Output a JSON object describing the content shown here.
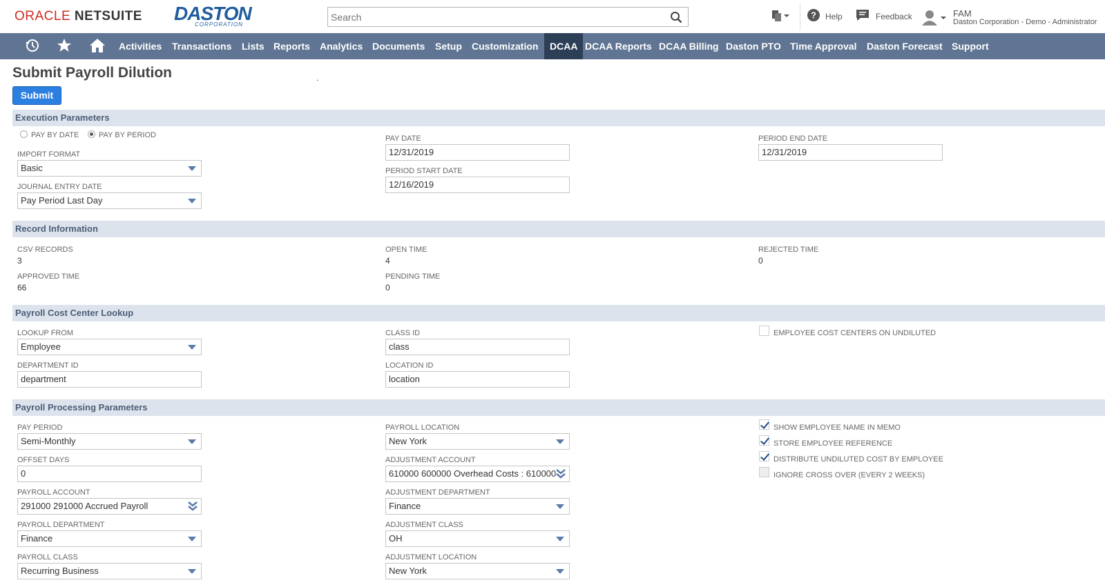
{
  "header": {
    "oracle_word": "ORACLE",
    "netsuite_word": "NETSUITE",
    "daston_word": "DASTON",
    "daston_sub": "CORPORATION",
    "search_placeholder": "Search",
    "help_label": "Help",
    "feedback_label": "Feedback",
    "user_initials": "FAM",
    "user_role": "Daston Corporation - Demo - Administrator"
  },
  "nav": {
    "items": [
      "Activities",
      "Transactions",
      "Lists",
      "Reports",
      "Analytics",
      "Documents",
      "Setup",
      "Customization",
      "DCAA",
      "DCAA Reports",
      "DCAA Billing",
      "Daston PTO",
      "Time Approval",
      "Daston Forecast",
      "Support"
    ],
    "active": "DCAA"
  },
  "page": {
    "title": "Submit Payroll Dilution",
    "dot": ".",
    "submit_label": "Submit"
  },
  "execution": {
    "section_title": "Execution Parameters",
    "radio_by_date": "PAY BY DATE",
    "radio_by_period": "PAY BY PERIOD",
    "import_format_label": "IMPORT FORMAT",
    "import_format_value": "Basic",
    "je_date_label": "JOURNAL ENTRY DATE",
    "je_date_value": "Pay Period Last Day",
    "pay_date_label": "PAY DATE",
    "pay_date_value": "12/31/2019",
    "period_start_label": "PERIOD START DATE",
    "period_start_value": "12/16/2019",
    "period_end_label": "PERIOD END DATE",
    "period_end_value": "12/31/2019"
  },
  "record": {
    "section_title": "Record Information",
    "csv_label": "CSV RECORDS",
    "csv_value": "3",
    "approved_label": "APPROVED TIME",
    "approved_value": "66",
    "open_label": "OPEN TIME",
    "open_value": "4",
    "pending_label": "PENDING TIME",
    "pending_value": "0",
    "rejected_label": "REJECTED TIME",
    "rejected_value": "0"
  },
  "lookup": {
    "section_title": "Payroll Cost Center Lookup",
    "lookup_from_label": "LOOKUP FROM",
    "lookup_from_value": "Employee",
    "dept_id_label": "DEPARTMENT ID",
    "dept_id_value": "department",
    "class_id_label": "CLASS ID",
    "class_id_value": "class",
    "location_id_label": "LOCATION ID",
    "location_id_value": "location",
    "emp_cc_label": "EMPLOYEE COST CENTERS ON UNDILUTED"
  },
  "processing": {
    "section_title": "Payroll Processing Parameters",
    "pay_period_label": "PAY PERIOD",
    "pay_period_value": "Semi-Monthly",
    "offset_label": "OFFSET DAYS",
    "offset_value": "0",
    "payroll_account_label": "PAYROLL ACCOUNT",
    "payroll_account_value": "291000 291000 Accrued Payroll",
    "payroll_dept_label": "PAYROLL DEPARTMENT",
    "payroll_dept_value": "Finance",
    "payroll_class_label": "PAYROLL CLASS",
    "payroll_class_value": "Recurring Business",
    "payroll_location_label": "PAYROLL LOCATION",
    "payroll_location_value": "New York",
    "adj_account_label": "ADJUSTMENT ACCOUNT",
    "adj_account_value": "610000 600000 Overhead Costs : 610000",
    "adj_dept_label": "ADJUSTMENT DEPARTMENT",
    "adj_dept_value": "Finance",
    "adj_class_label": "ADJUSTMENT CLASS",
    "adj_class_value": "OH",
    "adj_location_label": "ADJUSTMENT LOCATION",
    "adj_location_value": "New York",
    "show_name_label": "SHOW EMPLOYEE NAME IN MEMO",
    "store_ref_label": "STORE EMPLOYEE REFERENCE",
    "distribute_label": "DISTRIBUTE UNDILUTED COST BY EMPLOYEE",
    "ignore_label": "IGNORE CROSS OVER (EVERY 2 WEEKS)"
  },
  "colors": {
    "nav_bg": "#5f7593",
    "nav_active": "#2d3e57",
    "section_bg": "#dde3ec",
    "section_text": "#4a5d77",
    "submit_bg": "#2a7fe0",
    "oracle_red": "#d12a1f",
    "daston_blue": "#1f5c9e"
  }
}
